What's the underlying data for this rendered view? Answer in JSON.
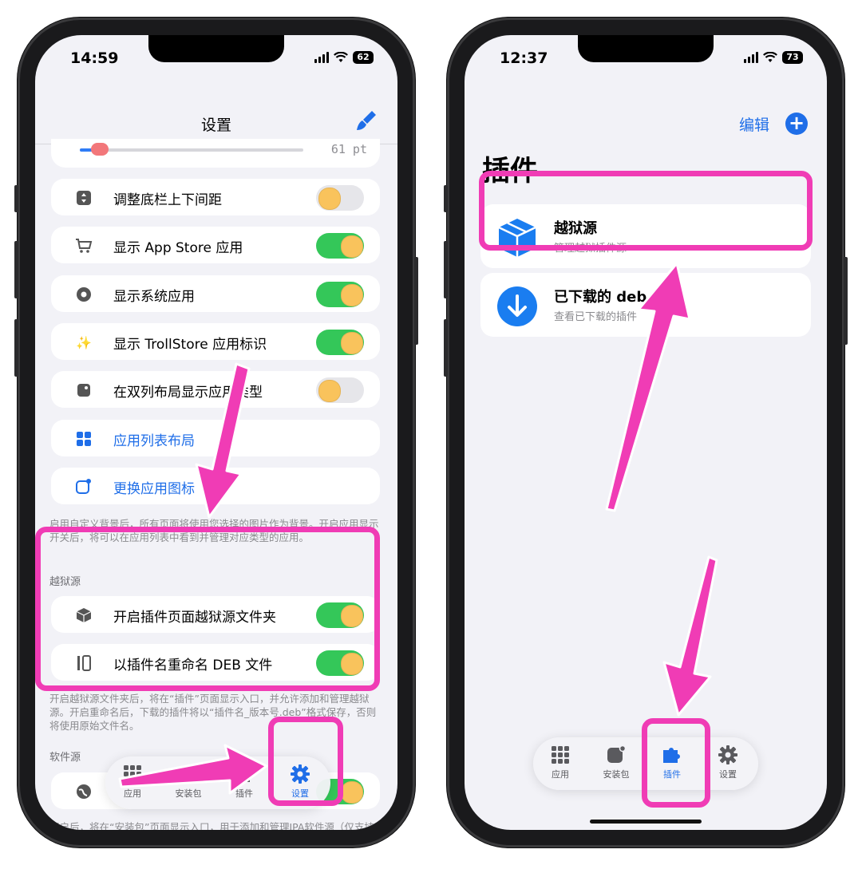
{
  "left_screen": {
    "status": {
      "time": "14:59",
      "battery": "62"
    },
    "nav_title": "设置",
    "slider_value": "61 pt",
    "rows": [
      {
        "label": "调整底栏上下间距",
        "toggle": "off"
      },
      {
        "label": "显示 App Store 应用",
        "toggle": "on"
      },
      {
        "label": "显示系统应用",
        "toggle": "on"
      },
      {
        "label": "显示 TrollStore 应用标识",
        "toggle": "on"
      },
      {
        "label": "在双列布局显示应用类型",
        "toggle": "off"
      },
      {
        "label": "应用列表布局"
      },
      {
        "label": "更换应用图标"
      }
    ],
    "footnote_1": "启用自定义背景后，所有页面将使用您选择的图片作为背景。开启应用显示开关后，将可以在应用列表中看到并管理对应类型的应用。",
    "section_jailbreak": "越狱源",
    "jb_rows": [
      {
        "label": "开启插件页面越狱源文件夹",
        "toggle": "on"
      },
      {
        "label": "以插件名重命名 DEB 文件",
        "toggle": "on"
      }
    ],
    "footnote_2": "开启越狱源文件夹后，将在“插件”页面显示入口，并允许添加和管理越狱源。开启重命名后，下载的插件将以“插件名_版本号.deb”格式保存，否则将使用原始文件名。",
    "section_software": "软件源",
    "footnote_3": "开启后，将在“安装包”页面显示入口，用于添加和管理IPA软件源（仅支持未加密 JSON 格式的软件源）",
    "tabbar": [
      {
        "label": "应用",
        "icon": "grid-icon"
      },
      {
        "label": "安装包",
        "icon": "package-icon"
      },
      {
        "label": "插件",
        "icon": "puzzle-icon"
      },
      {
        "label": "设置",
        "icon": "gear-icon",
        "active": true
      }
    ]
  },
  "right_screen": {
    "status": {
      "time": "12:37",
      "battery": "73"
    },
    "edit_label": "编辑",
    "plus_label": "+",
    "title": "插件",
    "cards": [
      {
        "title": "越狱源",
        "subtitle": "管理越狱插件源",
        "icon": "box-icon"
      },
      {
        "title": "已下载的 deb",
        "subtitle": "查看已下载的插件",
        "icon": "download-icon"
      }
    ],
    "tabbar": [
      {
        "label": "应用",
        "icon": "grid-icon"
      },
      {
        "label": "安装包",
        "icon": "package-icon"
      },
      {
        "label": "插件",
        "icon": "puzzle-icon",
        "active": true
      },
      {
        "label": "设置",
        "icon": "gear-icon"
      }
    ]
  },
  "colors": {
    "accent": "#1f6ee8",
    "toggle_on": "#34c759",
    "knob": "#f9c35c",
    "highlight": "#f03cb5"
  }
}
